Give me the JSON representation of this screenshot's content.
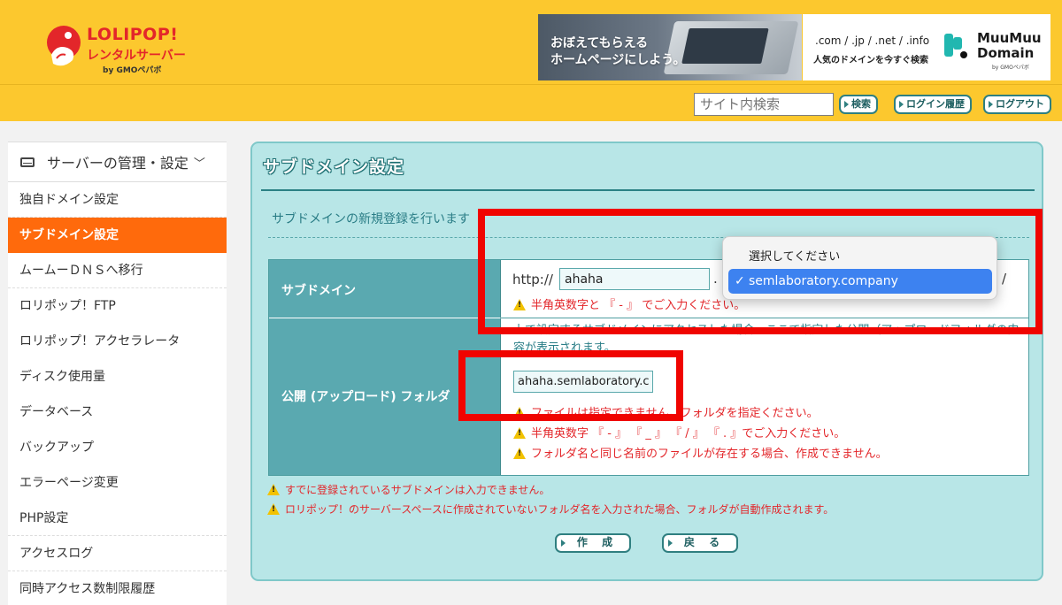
{
  "header": {
    "logo_title": "LOLIPOP!",
    "logo_sub": "レンタルサーバー",
    "logo_by": "by GMOペパボ",
    "banner1_line1": "おぼえてもらえる",
    "banner1_line2": "ホームページにしよう。",
    "banner2_tlds": ".com / .jp / .net / .info",
    "banner2_desc": "人気のドメインを今すぐ検索",
    "banner2_brand": "MuuMuu Domain",
    "banner2_by": "by GMOペパボ"
  },
  "toolbar": {
    "search_placeholder": "サイト内検索",
    "search_button": "検索",
    "login_history_button": "ログイン履歴",
    "logout_button": "ログアウト"
  },
  "sidebar": {
    "section_title": "サーバーの管理・設定",
    "items": [
      {
        "label": "独自ドメイン設定"
      },
      {
        "label": "サブドメイン設定",
        "active": true
      },
      {
        "label": "ムームーＤＮＳへ移行"
      },
      {
        "label": "ロリポップ！FTP"
      },
      {
        "label": "ロリポップ！アクセラレータ"
      },
      {
        "label": "ディスク使用量"
      },
      {
        "label": "データベース"
      },
      {
        "label": "バックアップ"
      },
      {
        "label": "エラーページ変更"
      },
      {
        "label": "PHP設定"
      },
      {
        "label": "アクセスログ"
      },
      {
        "label": "同時アクセス数制限履歴"
      }
    ]
  },
  "main": {
    "title": "サブドメイン設定",
    "intro": "サブドメインの新規登録を行います",
    "subdomain": {
      "label": "サブドメイン",
      "prefix": "http://",
      "value": "ahaha",
      "separator": ".",
      "suffix": "/",
      "warning": "半角英数字と 『 - 』 でご入力ください。"
    },
    "folder": {
      "label": "公開 (アップロード) フォルダ",
      "description": "上で設定するサブドメインにアクセスした場合、ここで指定した公開（アップロードフォルダの内容が表示されます。",
      "value": "ahaha.semlaboratory.c",
      "warnings": [
        "ファイルは指定できません。フォルダを指定ください。",
        "半角英数字 『 - 』 『 _ 』 『 / 』 『 . 』でご入力ください。",
        "フォルダ名と同じ名前のファイルが存在する場合、作成できません。"
      ]
    },
    "notes": [
      "すでに登録されているサブドメインは入力できません。",
      "ロリポップ！のサーバースペースに作成されていないフォルダ名を入力された場合、フォルダが自動作成されます。"
    ],
    "create_button": "作 成",
    "back_button": "戻 る"
  },
  "dropdown": {
    "placeholder_option": "選択してください",
    "selected_option": "semlaboratory.company",
    "check": "✓"
  },
  "colors": {
    "header_yellow": "#fcc82e",
    "active_orange": "#ff6a0c",
    "panel_bg": "#b8e6e7",
    "label_teal": "#5aa9b0",
    "warning_red": "#e3262a",
    "annotation_red": "#f00400",
    "select_blue": "#3d82f0"
  }
}
